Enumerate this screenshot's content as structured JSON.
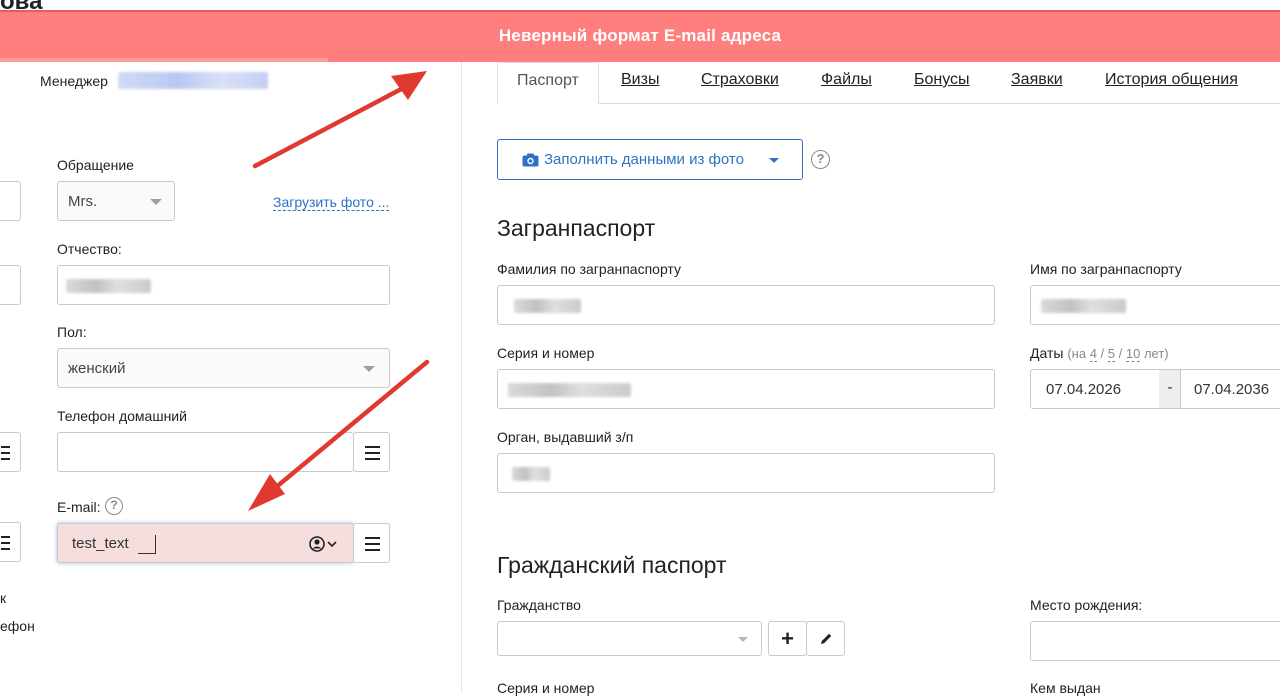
{
  "page": {
    "cut_heading": "ова"
  },
  "banner": {
    "message": "Неверный формат E-mail адреса"
  },
  "left": {
    "manager_label": "Менеджер",
    "salutation_label": "Обращение",
    "salutation_value": "Mrs.",
    "upload_photo_link": "Загрузить фото ...",
    "patronymic_label": "Отчество:",
    "gender_label": "Пол:",
    "gender_value": "женский",
    "home_phone_label": "Телефон домашний",
    "home_phone_value": "",
    "email_label": "E-mail:",
    "email_value": "test_text",
    "cut_label_1": "к",
    "cut_label_2": "ефон"
  },
  "tabs": [
    "Паспорт",
    "Визы",
    "Страховки",
    "Файлы",
    "Бонусы",
    "Заявки",
    "История общения"
  ],
  "right": {
    "fill_from_photo_label": "Заполнить данными из фото",
    "foreign_passport_heading": "Загранпаспорт",
    "surname_label": "Фамилия по загранпаспорту",
    "name_label": "Имя по загранпаспорту",
    "series_number_label": "Серия и номер",
    "dates_label": "Даты",
    "dates_hint_prefix": "(на",
    "dates_hint_4": "4",
    "dates_hint_5": "5",
    "dates_hint_10": "10",
    "dates_hint_suffix": "лет)",
    "date_from": "07.04.2026",
    "date_sep": "-",
    "date_to": "07.04.2036",
    "issuer_label": "Орган, выдавший з/п",
    "civil_passport_heading": "Гражданский паспорт",
    "citizenship_label": "Гражданство",
    "birthplace_label": "Место рождения:",
    "civil_series_label": "Серия и номер",
    "issued_by_label": "Кем выдан"
  },
  "colors": {
    "banner": "#ff7f7f",
    "accent": "#2f72c5",
    "arrow": "#e0392f",
    "error_field": "#f7dede"
  },
  "icons": [
    "camera-icon",
    "dropdown-caret-icon",
    "help-icon",
    "menu-icon",
    "contact-icon",
    "plus-icon",
    "pencil-icon"
  ]
}
